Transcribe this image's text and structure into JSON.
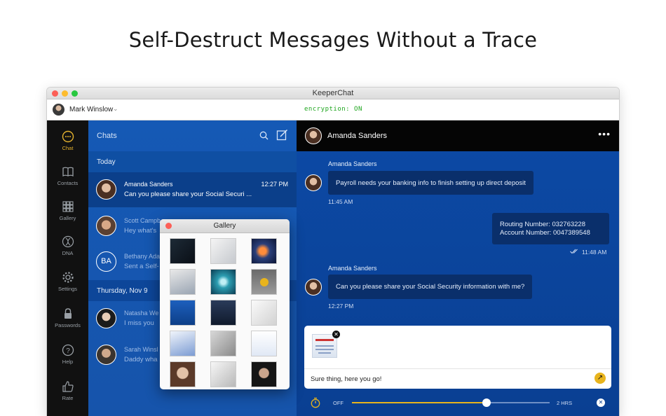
{
  "headline": "Self-Destruct Messages Without a Trace",
  "window": {
    "title": "KeeperChat",
    "user_name": "Mark Winslow",
    "encryption": "encryption: ON"
  },
  "rail": [
    {
      "label": "Chat",
      "icon": "chat-bubble-icon",
      "active": true
    },
    {
      "label": "Contacts",
      "icon": "book-icon"
    },
    {
      "label": "Gallery",
      "icon": "grid-icon"
    },
    {
      "label": "DNA",
      "icon": "dna-icon"
    },
    {
      "label": "Settings",
      "icon": "gear-icon"
    },
    {
      "label": "Passwords",
      "icon": "lock-icon"
    },
    {
      "label": "Help",
      "icon": "help-icon"
    },
    {
      "label": "Rate",
      "icon": "thumbs-up-icon"
    }
  ],
  "chats": {
    "title": "Chats",
    "today": "Today",
    "earlier": "Thursday, Nov 9",
    "rows": [
      {
        "name": "Amanda Sanders",
        "time": "12:27 PM",
        "preview": "Can you please share your Social Securi ..."
      },
      {
        "name": "Scott Campb",
        "time": "",
        "preview": "Hey what's"
      },
      {
        "name": "Bethany Ada",
        "time": "",
        "preview": "Sent a Self-",
        "initials": "BA"
      },
      {
        "name": "Natasha We",
        "time": "",
        "preview": "I miss you"
      },
      {
        "name": "Sarah Winsl",
        "time": "",
        "preview": "Daddy wha"
      }
    ]
  },
  "conversation": {
    "contact": "Amanda Sanders",
    "messages": [
      {
        "sender": "Amanda Sanders",
        "text": "Payroll needs your banking info to finish setting up direct deposit",
        "time": "11:45 AM"
      },
      {
        "line1": "Routing Number: 032763228",
        "line2": "Account Number: 0047389548",
        "time": "11:48 AM"
      },
      {
        "sender": "Amanda Sanders",
        "text": "Can you please share your Social Security information with me?",
        "time": "12:27 PM"
      }
    ],
    "composer_text": "Sure thing, here you go!",
    "timer": {
      "off_label": "OFF",
      "max_label": "2 HRS",
      "level": 0.68
    }
  },
  "gallery": {
    "title": "Gallery"
  },
  "colors": {
    "accent": "#e8b41d",
    "encryption": "#1da51d",
    "chat_blue": "#1559b5"
  }
}
